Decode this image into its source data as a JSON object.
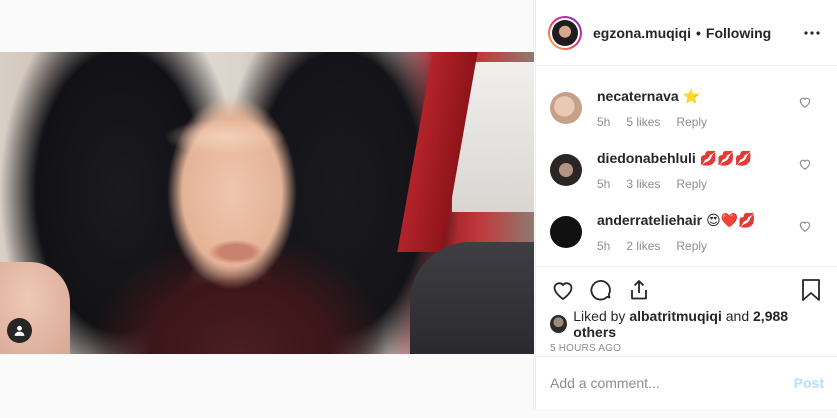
{
  "post": {
    "author": "egzona.muqiqi",
    "separator": "•",
    "follow_status": "Following",
    "more_icon": "more-horizontal-icon"
  },
  "media": {
    "user_tag_icon": "user-tag-icon"
  },
  "comments": [
    {
      "user": "necaternava",
      "text": "⭐",
      "time": "5h",
      "likes": "5 likes",
      "reply": "Reply",
      "avatar_color": "#d8b39a"
    },
    {
      "user": "diedonabehluli",
      "text": "💋💋💋",
      "time": "5h",
      "likes": "3 likes",
      "reply": "Reply",
      "avatar_color": "#6a5a4f"
    },
    {
      "user": "anderrateliehair",
      "text": "😍❤️💋",
      "time": "5h",
      "likes": "2 likes",
      "reply": "Reply",
      "avatar_color": "#111111"
    }
  ],
  "actions": {
    "like_icon": "heart-icon",
    "comment_icon": "comment-icon",
    "share_icon": "share-icon",
    "save_icon": "bookmark-icon"
  },
  "likes": {
    "prefix": "Liked by",
    "first_user": "albatritmuqiqi",
    "conjunction": "and",
    "others": "2,988 others"
  },
  "timestamp": "5 HOURS AGO",
  "add_comment": {
    "placeholder": "Add a comment...",
    "post_label": "Post"
  },
  "colors": {
    "text": "#262626",
    "muted": "#8e8e8e",
    "border": "#efefef",
    "post_disabled": "#b2dffc"
  }
}
